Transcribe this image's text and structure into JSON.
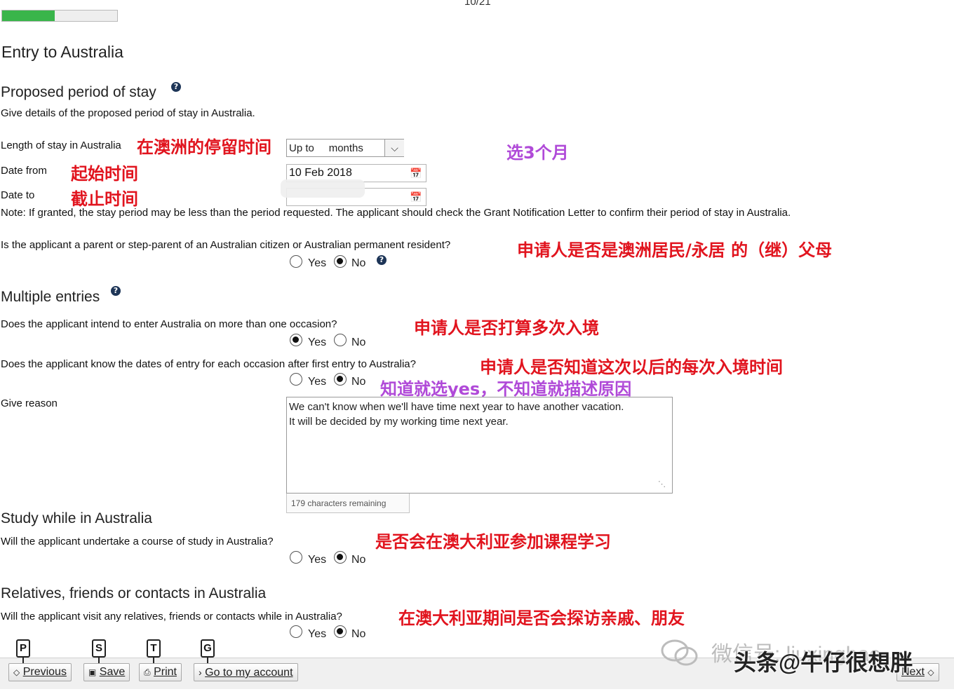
{
  "progress": {
    "page_label": "10/21",
    "fraction": 0.46
  },
  "page_title": "Entry to Australia",
  "stay": {
    "heading": "Proposed period of stay",
    "description": "Give details of the proposed period of stay in Australia.",
    "length_label": "Length of stay in Australia",
    "length_value_prefix": "Up to",
    "length_value_suffix": "months",
    "date_from_label": "Date from",
    "date_from_value": "10 Feb 2018",
    "date_to_label": "Date to",
    "date_to_value": "",
    "note": "Note: If granted, the stay period may be less than the period requested. The applicant should check the Grant Notification Letter to confirm their period of stay in Australia.",
    "parent_question": "Is the applicant a parent or step-parent of an Australian citizen or Australian permanent resident?",
    "parent_answer": "No"
  },
  "multiple": {
    "heading": "Multiple entries",
    "intend_question": "Does the applicant intend to enter Australia on more than one occasion?",
    "intend_answer": "Yes",
    "know_question": "Does the applicant know the dates of entry for each occasion after first entry to Australia?",
    "know_answer": "No",
    "reason_label": "Give reason",
    "reason_line1": "We can't know  when we'll have time next year to have another vacation.",
    "reason_line2": "It will be decided by my working time next year.",
    "chars_remaining": "179 characters remaining"
  },
  "study": {
    "heading": "Study while in Australia",
    "question": "Will the applicant undertake a course of study in Australia?",
    "answer": "No"
  },
  "relatives": {
    "heading": "Relatives, friends or contacts in Australia",
    "question": "Will the applicant visit any relatives, friends or contacts while in Australia?",
    "answer": "No"
  },
  "radio_labels": {
    "yes": "Yes",
    "no": "No"
  },
  "help_glyph": "?",
  "annotations": {
    "length": "在澳洲的停留时间",
    "choose_3": "选3个月",
    "date_from": "起始时间",
    "date_to": "截止时间",
    "parent": "申请人是否是澳洲居民/永居 的（继）父母",
    "intend": "申请人是否打算多次入境",
    "know": "申请人是否知道这次以后的每次入境时间",
    "know_hint": "知道就选yes，不知道就描述原因",
    "study": "是否会在澳大利亚参加课程学习",
    "relatives": "在澳大利亚期间是否会探访亲戚、朋友"
  },
  "footer": {
    "previous": "Previous",
    "save": "Save",
    "print": "Print",
    "account": "Go to my account",
    "next": "Next",
    "key_p": "P",
    "key_s": "S",
    "key_t": "T",
    "key_g": "G"
  },
  "watermark": {
    "wechat": "微信号: liuxingbao",
    "toutiao": "头条@牛仔很想胖"
  },
  "colors": {
    "annotation_red": "#e1141e",
    "annotation_purple": "#b04ad8",
    "progress_green": "#39b54a"
  },
  "icons": {
    "calendar": "calendar-icon",
    "dropdown": "chevron-down-icon",
    "help": "help-icon"
  }
}
